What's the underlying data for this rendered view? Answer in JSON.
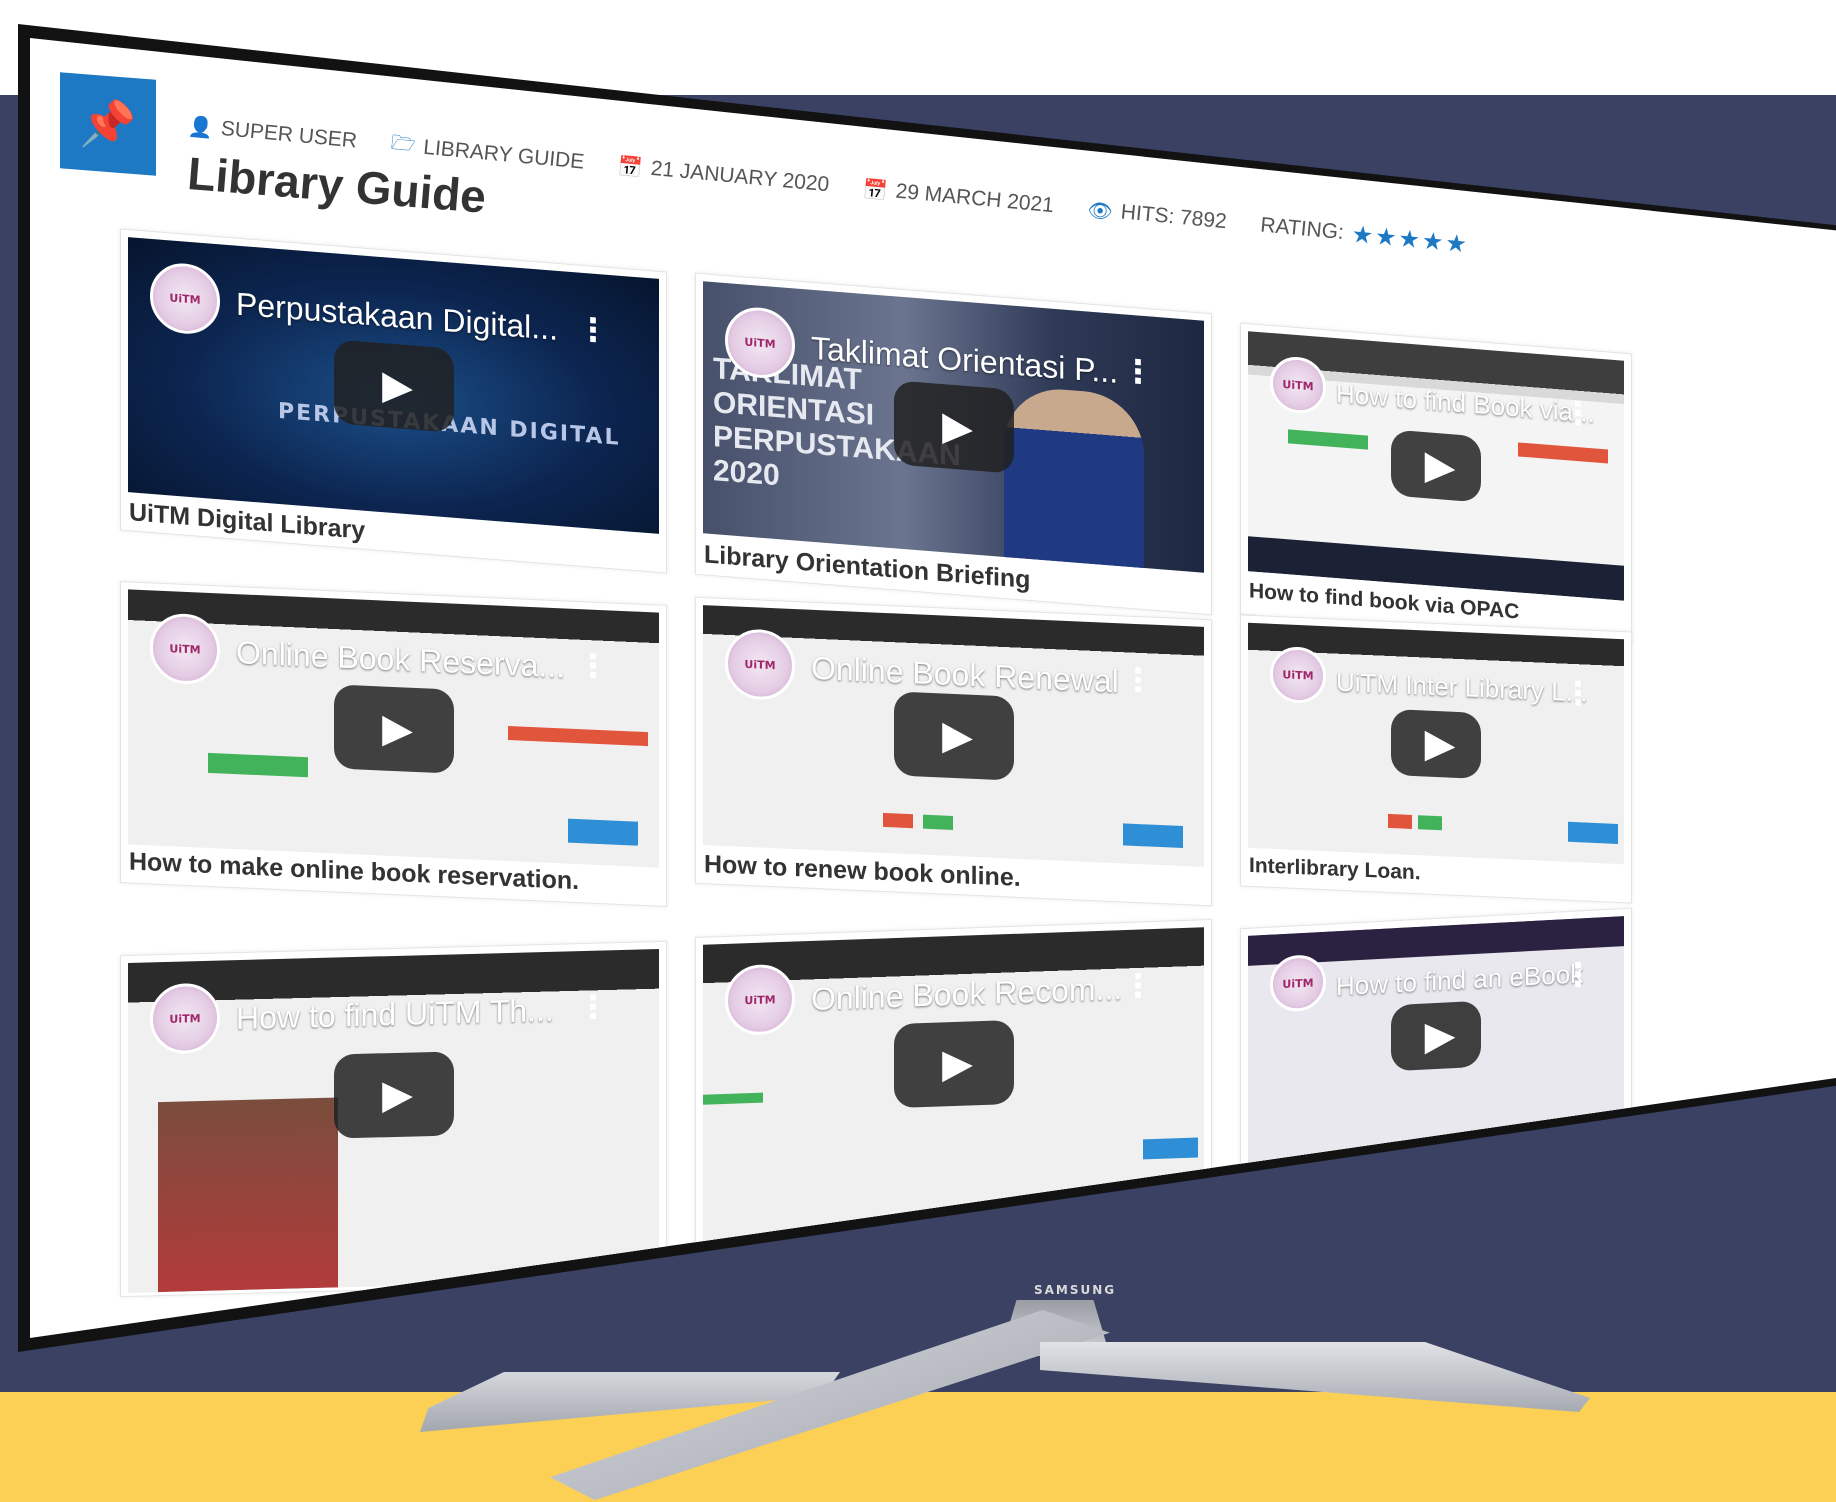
{
  "page": {
    "meta": {
      "author": "SUPER USER",
      "category": "LIBRARY GUIDE",
      "created": "21 JANUARY 2020",
      "modified": "29 MARCH 2021",
      "hits": "HITS: 7892",
      "rating_label": "RATING:",
      "rating_stars": "★★★★★"
    },
    "title": "Library Guide",
    "tv_brand": "SAMSUNG"
  },
  "icons": {
    "pin": "📌",
    "user": "👤",
    "folder": "🗁",
    "calendar": "📅",
    "eye": "👁",
    "play": "▶",
    "kebab": "⋮"
  },
  "colors": {
    "accent": "#1e79c4",
    "navy": "#3a4163",
    "yellow": "#fccf55"
  },
  "videos": [
    {
      "title": "Perpustakaan Digital...",
      "caption": "UiTM Digital Library",
      "overlay": "PERPUSTAKAAN DIGITAL"
    },
    {
      "title": "Taklimat Orientasi P...",
      "caption": "Library Orientation Briefing",
      "overlay": "TAKLIMAT ORIENTASI PERPUSTAKAAN 2020"
    },
    {
      "title": "How to find Book via...",
      "caption": "How to find book via OPAC"
    },
    {
      "title": "Online Book Reserva...",
      "caption": "How to make online book reservation."
    },
    {
      "title": "Online Book Renewal",
      "caption": "How to renew book online."
    },
    {
      "title": "UiTM Inter Library L...",
      "caption": "Interlibrary Loan."
    },
    {
      "title": "How to find UiTM Th...",
      "caption": ""
    },
    {
      "title": "Online Book Recom...",
      "caption": ""
    },
    {
      "title": "How to find an eBook",
      "caption": ""
    }
  ]
}
